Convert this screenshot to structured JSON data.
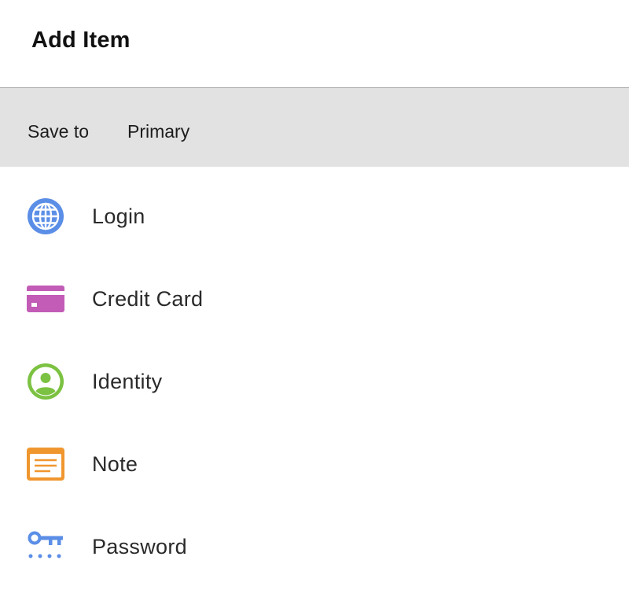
{
  "header": {
    "title": "Add Item"
  },
  "save_to": {
    "label": "Save to",
    "value": "Primary"
  },
  "items": [
    {
      "label": "Login",
      "icon": "globe-icon",
      "color": "#5b8ee6"
    },
    {
      "label": "Credit Card",
      "icon": "credit-card-icon",
      "color": "#c25cb6"
    },
    {
      "label": "Identity",
      "icon": "identity-icon",
      "color": "#7cc242"
    },
    {
      "label": "Note",
      "icon": "note-icon",
      "color": "#f0962e"
    },
    {
      "label": "Password",
      "icon": "key-icon",
      "color": "#5b8ee6"
    }
  ]
}
